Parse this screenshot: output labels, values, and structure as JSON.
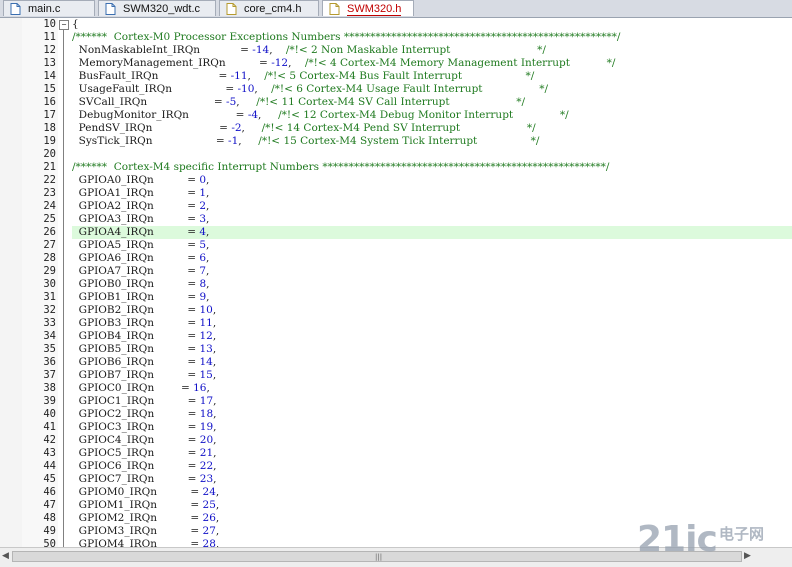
{
  "tabs": [
    {
      "label": "main.c",
      "active": false
    },
    {
      "label": "SWM320_wdt.c",
      "active": false
    },
    {
      "label": "core_cm4.h",
      "active": false
    },
    {
      "label": "SWM320.h",
      "active": true
    }
  ],
  "colors": {
    "comment": "#1f7a1f",
    "number": "#1010c8",
    "active_tab_text": "#c00000",
    "current_line": "#dcfadc"
  },
  "highlighted_line": "26",
  "lines": [
    {
      "n": "10",
      "t": "{"
    },
    {
      "n": "11",
      "t": "/******  Cortex-M0 Processor Exceptions Numbers ****************************************************/"
    },
    {
      "n": "12",
      "t": "  NonMaskableInt_IRQn            = -14,    /*!< 2 Non Maskable Interrupt                          */"
    },
    {
      "n": "13",
      "t": "  MemoryManagement_IRQn          = -12,    /*!< 4 Cortex-M4 Memory Management Interrupt           */"
    },
    {
      "n": "14",
      "t": "  BusFault_IRQn                  = -11,    /*!< 5 Cortex-M4 Bus Fault Interrupt                   */"
    },
    {
      "n": "15",
      "t": "  UsageFault_IRQn                = -10,    /*!< 6 Cortex-M4 Usage Fault Interrupt                 */"
    },
    {
      "n": "16",
      "t": "  SVCall_IRQn                    = -5,     /*!< 11 Cortex-M4 SV Call Interrupt                    */"
    },
    {
      "n": "17",
      "t": "  DebugMonitor_IRQn              = -4,     /*!< 12 Cortex-M4 Debug Monitor Interrupt              */"
    },
    {
      "n": "18",
      "t": "  PendSV_IRQn                    = -2,     /*!< 14 Cortex-M4 Pend SV Interrupt                    */"
    },
    {
      "n": "19",
      "t": "  SysTick_IRQn                   = -1,     /*!< 15 Cortex-M4 System Tick Interrupt                */"
    },
    {
      "n": "20",
      "t": ""
    },
    {
      "n": "21",
      "t": "/******  Cortex-M4 specific Interrupt Numbers ******************************************************/"
    },
    {
      "n": "22",
      "t": "  GPIOA0_IRQn          = 0,"
    },
    {
      "n": "23",
      "t": "  GPIOA1_IRQn          = 1,"
    },
    {
      "n": "24",
      "t": "  GPIOA2_IRQn          = 2,"
    },
    {
      "n": "25",
      "t": "  GPIOA3_IRQn          = 3,"
    },
    {
      "n": "26",
      "t": "  GPIOA4_IRQn          = 4,"
    },
    {
      "n": "27",
      "t": "  GPIOA5_IRQn          = 5,"
    },
    {
      "n": "28",
      "t": "  GPIOA6_IRQn          = 6,"
    },
    {
      "n": "29",
      "t": "  GPIOA7_IRQn          = 7,"
    },
    {
      "n": "30",
      "t": "  GPIOB0_IRQn          = 8,"
    },
    {
      "n": "31",
      "t": "  GPIOB1_IRQn          = 9,"
    },
    {
      "n": "32",
      "t": "  GPIOB2_IRQn          = 10,"
    },
    {
      "n": "33",
      "t": "  GPIOB3_IRQn          = 11,"
    },
    {
      "n": "34",
      "t": "  GPIOB4_IRQn          = 12,"
    },
    {
      "n": "35",
      "t": "  GPIOB5_IRQn          = 13,"
    },
    {
      "n": "36",
      "t": "  GPIOB6_IRQn          = 14,"
    },
    {
      "n": "37",
      "t": "  GPIOB7_IRQn          = 15,"
    },
    {
      "n": "38",
      "t": "  GPIOC0_IRQn        = 16,"
    },
    {
      "n": "39",
      "t": "  GPIOC1_IRQn          = 17,"
    },
    {
      "n": "40",
      "t": "  GPIOC2_IRQn          = 18,"
    },
    {
      "n": "41",
      "t": "  GPIOC3_IRQn          = 19,"
    },
    {
      "n": "42",
      "t": "  GPIOC4_IRQn          = 20,"
    },
    {
      "n": "43",
      "t": "  GPIOC5_IRQn          = 21,"
    },
    {
      "n": "44",
      "t": "  GPIOC6_IRQn          = 22,"
    },
    {
      "n": "45",
      "t": "  GPIOC7_IRQn          = 23,"
    },
    {
      "n": "46",
      "t": "  GPIOM0_IRQn          = 24,"
    },
    {
      "n": "47",
      "t": "  GPIOM1_IRQn          = 25,"
    },
    {
      "n": "48",
      "t": "  GPIOM2_IRQn          = 26,"
    },
    {
      "n": "49",
      "t": "  GPIOM3_IRQn          = 27,"
    },
    {
      "n": "50",
      "t": "  GPIOM4_IRQn          = 28,"
    }
  ],
  "watermark": {
    "main": "21ic",
    "sub": "电子网"
  },
  "scrollbar": {
    "left_arrow": "◀",
    "right_arrow": "▶",
    "grip": "|||"
  }
}
